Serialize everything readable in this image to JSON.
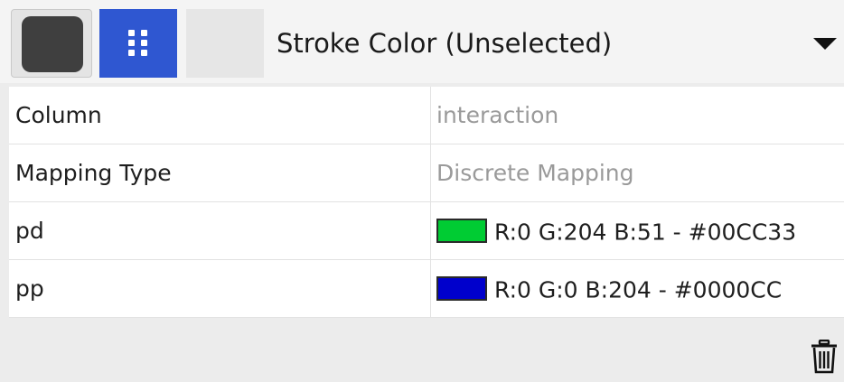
{
  "header": {
    "property_title": "Stroke Color (Unselected)",
    "default_swatch_color": "#3f3f3f",
    "mapping_button_color": "#2f57d1",
    "mapping_icon": "grip-icon",
    "dropdown_icon": "triangle-down-icon"
  },
  "table": {
    "rows": [
      {
        "key": "Column",
        "value": "interaction"
      },
      {
        "key": "Mapping Type",
        "value": "Discrete Mapping"
      },
      {
        "key": "pd",
        "value": "R:0 G:204 B:51 - #00CC33",
        "color": "#00CC33"
      },
      {
        "key": "pp",
        "value": "R:0 G:0 B:204 - #0000CC",
        "color": "#0000CC"
      }
    ]
  },
  "footer": {
    "delete_icon": "trash-icon"
  }
}
